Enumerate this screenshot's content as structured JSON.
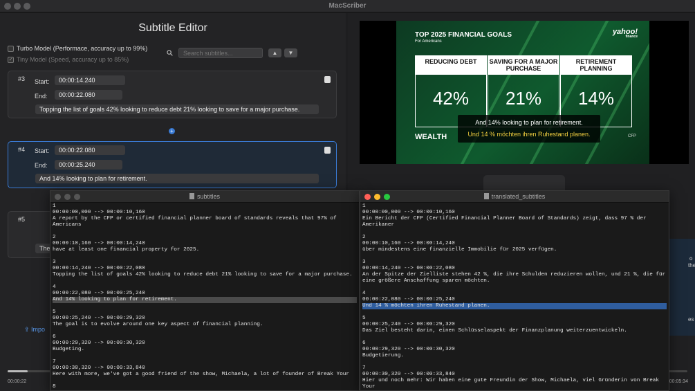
{
  "app": {
    "title": "MacScriber"
  },
  "editor": {
    "heading": "Subtitle Editor",
    "turbo_label": "Turbo Model (Performace, accuracy up to 99%)",
    "tiny_label": "Tiny Model (Speed, accuracy up to 85%)",
    "search_placeholder": "Search subtitles...",
    "start_label": "Start:",
    "end_label": "End:",
    "cards": [
      {
        "num": "#3",
        "start": "00:00:14.240",
        "end": "00:00:22.080",
        "text": "Topping the list of goals 42% looking to reduce debt 21% looking to save for a major purchase."
      },
      {
        "num": "#4",
        "start": "00:00:22.080",
        "end": "00:00:25.240",
        "text": "And 14% looking to plan for retirement."
      },
      {
        "num": "#5",
        "text": "The"
      }
    ],
    "import_label": "Impo"
  },
  "video": {
    "title": "TOP 2025 FINANCIAL GOALS",
    "subtitle": "For Americans",
    "brand": "yahoo!",
    "brand_sub": "finance",
    "stats": [
      {
        "label": "REDUCING DEBT",
        "value": "42%"
      },
      {
        "label": "SAVING FOR A MAJOR PURCHASE",
        "value": "21%"
      },
      {
        "label": "RETIREMENT PLANNING",
        "value": "14%"
      }
    ],
    "footer_left": "WEALTH",
    "footer_right": "CFP",
    "caption_original": "And 14% looking to plan for retirement.",
    "caption_translated": "Und 14 % möchten ihren Ruhestand planen."
  },
  "right_side": {
    "text1": "o",
    "text2": "the",
    "text3": "es"
  },
  "player": {
    "elapsed": "00:00:22",
    "total": "00:05:34",
    "progress_fraction": 0.03
  },
  "windows": {
    "original": {
      "title": "subtitles",
      "blocks": [
        {
          "index": "1",
          "time": "00:00:00,000 --> 00:00:10,160",
          "lines": [
            "A report by the CFP or certified financial planner board of standards reveals that 97% of",
            "Americans"
          ]
        },
        {
          "index": "2",
          "time": "00:00:10,160 --> 00:00:14,240",
          "lines": [
            "have at least one financial property for 2025."
          ]
        },
        {
          "index": "3",
          "time": "00:00:14,240 --> 00:00:22,080",
          "lines": [
            "Topping the list of goals 42% looking to reduce debt 21% looking to save for a major purchase."
          ]
        },
        {
          "index": "4",
          "time": "00:00:22,080 --> 00:00:25,240",
          "lines": [
            "And 14% looking to plan for retirement."
          ]
        },
        {
          "index": "5",
          "time": "00:00:25,240 --> 00:00:29,320",
          "lines": [
            "The goal is to evolve around one key aspect of financial planning."
          ]
        },
        {
          "index": "6",
          "time": "00:00:29,320 --> 00:00:30,320",
          "lines": [
            "Budgeting."
          ]
        },
        {
          "index": "7",
          "time": "00:00:30,320 --> 00:00:33,840",
          "lines": [
            "Here with more, we've got a good friend of the show, Michaela, a lot of founder of Break Your"
          ]
        },
        {
          "index": "8",
          "time": "",
          "lines": []
        }
      ]
    },
    "translated": {
      "title": "translated_subtitles",
      "blocks": [
        {
          "index": "1",
          "time": "00:00:00,000 --> 00:00:10,160",
          "lines": [
            "Ein Bericht der CFP (Certified Financial Planner Board of Standards) zeigt, dass 97 % der",
            "Amerikaner"
          ]
        },
        {
          "index": "2",
          "time": "00:00:10,160 --> 00:00:14,240",
          "lines": [
            "über mindestens eine finanzielle Immobilie für 2025 verfügen."
          ]
        },
        {
          "index": "3",
          "time": "00:00:14,240 --> 00:00:22,080",
          "lines": [
            "An der Spitze der Zielliste stehen 42 %, die ihre Schulden reduzieren wollen, und 21 %, die für",
            "eine größere Anschaffung sparen möchten."
          ]
        },
        {
          "index": "4",
          "time": "00:00:22,080 --> 00:00:25,240",
          "lines": [
            "Und 14 % möchten ihren Ruhestand planen."
          ]
        },
        {
          "index": "5",
          "time": "00:00:25,240 --> 00:00:29,320",
          "lines": [
            "Das Ziel besteht darin, einen Schlüsselaspekt der Finanzplanung weiterzuentwickeln."
          ]
        },
        {
          "index": "6",
          "time": "00:00:29,320 --> 00:00:30,320",
          "lines": [
            "Budgetierung."
          ]
        },
        {
          "index": "7",
          "time": "00:00:30,320 --> 00:00:33,840",
          "lines": [
            "Hier und noch mehr: Wir haben eine gute Freundin der Show, Michaela, viel Gründerin von Break",
            "Your"
          ]
        }
      ]
    }
  }
}
